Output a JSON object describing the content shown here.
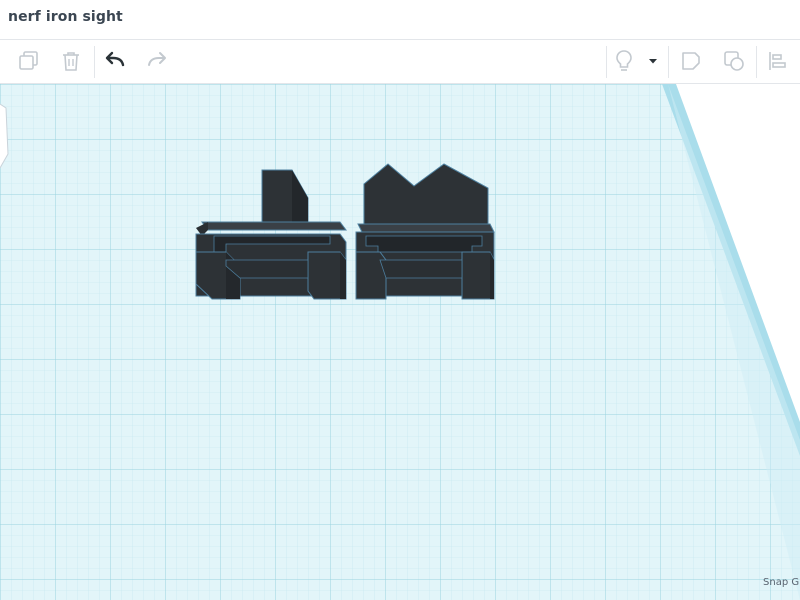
{
  "app": {
    "title": "nerf iron sight"
  },
  "toolbar": {
    "copy_icon": "copy-icon",
    "delete_icon": "trash-icon",
    "undo_icon": "undo-arrow-icon",
    "redo_icon": "redo-arrow-icon",
    "light_icon": "lightbulb-icon",
    "dropdown_icon": "chevron-down-icon",
    "note_icon": "note-shape-icon",
    "ruler_icon": "shape-group-icon",
    "align_icon": "align-left-icon"
  },
  "workplane": {
    "snap_label": "Snap Gri"
  },
  "colors": {
    "grid_background": "#dff4f8",
    "grid_minor": "#b8e3ec",
    "grid_major": "#8fcfdd",
    "workplane_edge": "#9ed8e6",
    "shape_fill": "#2e3338",
    "shape_edge": "#4a7fa0"
  }
}
